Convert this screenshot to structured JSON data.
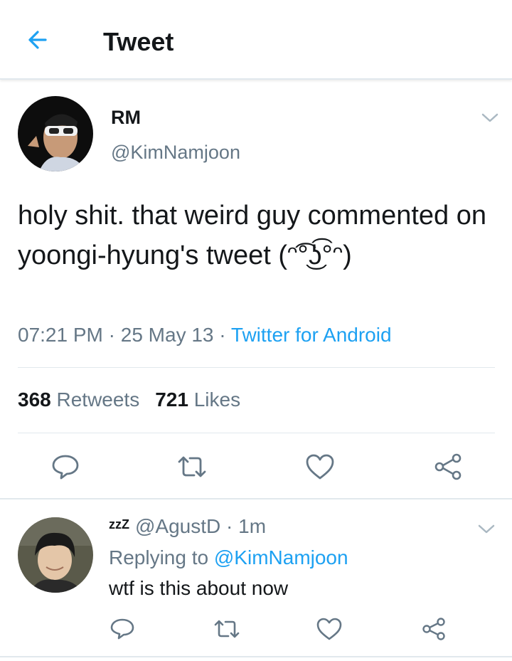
{
  "header": {
    "title": "Tweet",
    "back_icon": "arrow-left-icon"
  },
  "colors": {
    "accent": "#1da1f2",
    "secondary_text": "#657786",
    "divider": "#e1e8ed"
  },
  "tweet": {
    "name": "RM",
    "handle": "@KimNamjoon",
    "text": "holy shit. that weird guy commented on yoongi-hyung's tweet (ᵔ͡°͜ʖ͡°ᵔ)",
    "time": "07:21 PM",
    "date": "25 May 13",
    "separator": " · ",
    "source": "Twitter for Android",
    "retweets_count": "368",
    "retweets_label": " Retweets",
    "likes_count": "721",
    "likes_label": " Likes"
  },
  "reply": {
    "badge": "zzZ",
    "handle": "@AgustD",
    "time": " · 1m",
    "replying_label": "Replying to ",
    "replying_to": "@KimNamjoon",
    "text": "wtf is this about now"
  },
  "actions": [
    "reply-icon",
    "retweet-icon",
    "like-icon",
    "share-icon"
  ]
}
